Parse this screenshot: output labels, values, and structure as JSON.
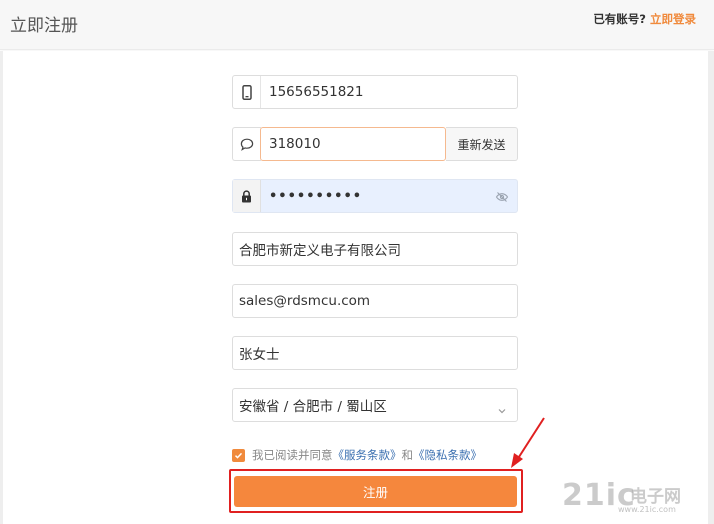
{
  "header": {
    "title": "立即注册",
    "has_account_text": "已有账号?",
    "login_link": "立即登录"
  },
  "form": {
    "phone": {
      "value": "15656551821",
      "icon": "phone-icon"
    },
    "code": {
      "value": "318010",
      "icon": "chat-bubble-icon",
      "resend_label": "重新发送"
    },
    "password": {
      "value": "••••••••••",
      "icon": "lock-icon",
      "toggle_icon": "eye-off-icon"
    },
    "company": {
      "value": "合肥市新定义电子有限公司"
    },
    "email": {
      "value": "sales@rdsmcu.com"
    },
    "name": {
      "value": "张女士"
    },
    "region": {
      "value": "安徽省 / 合肥市 / 蜀山区"
    },
    "agreement": {
      "checked": true,
      "prefix": "我已阅读并同意",
      "terms_link": "《服务条款》",
      "and": "和",
      "privacy_link": "《隐私条款》"
    },
    "submit_label": "注册"
  },
  "watermark": {
    "logo_text": "21ic",
    "cn_text": "电子网",
    "url": "www.21ic.com"
  },
  "colors": {
    "accent": "#f5873d",
    "link": "#3a6fb0",
    "highlight": "#e02020"
  }
}
